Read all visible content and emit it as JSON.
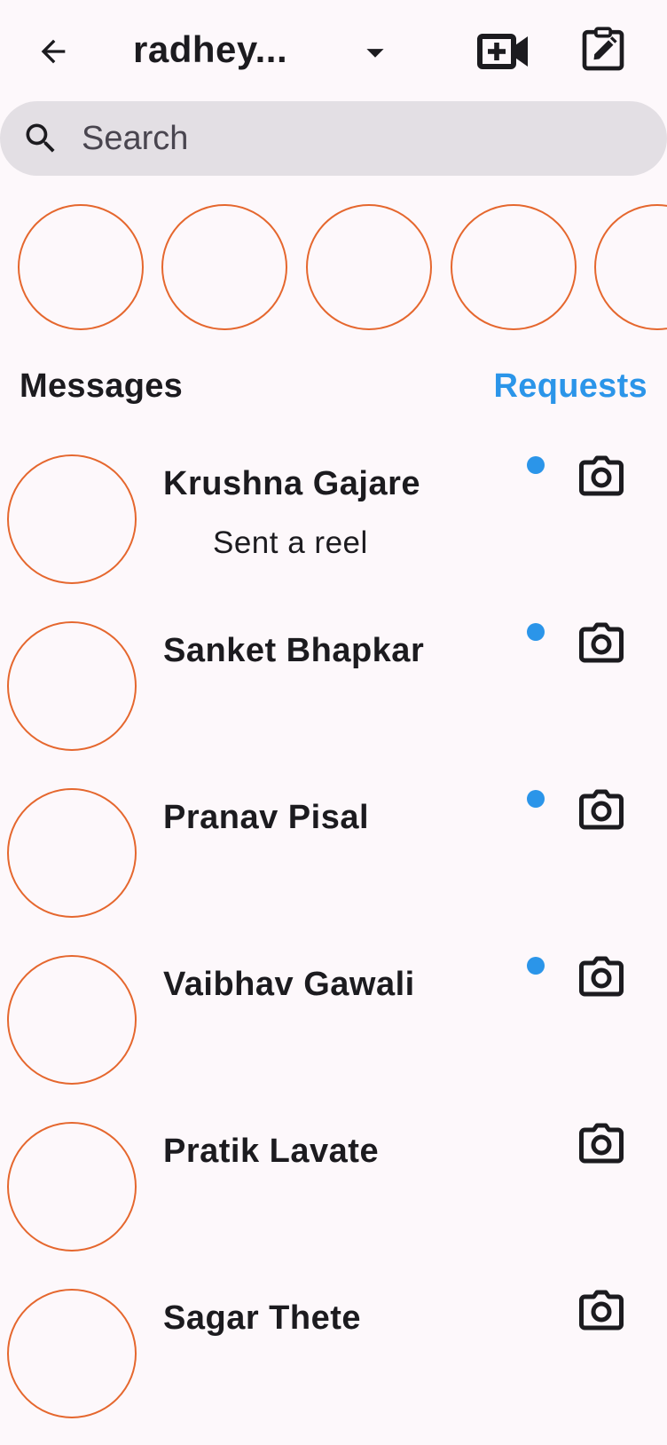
{
  "header": {
    "title": "radhey...",
    "back_icon": "arrow-left-icon",
    "dropdown_icon": "caret-down-icon",
    "video_icon": "video-call-add-icon",
    "compose_icon": "compose-edit-icon"
  },
  "search": {
    "placeholder": "Search",
    "value": ""
  },
  "stories": {
    "visible_count": 5,
    "ring_color": "#e5672e"
  },
  "section": {
    "messages_label": "Messages",
    "requests_label": "Requests",
    "accent_color": "#2b95e9"
  },
  "chats": [
    {
      "name": "Krushna Gajare",
      "subtitle": "Sent a reel",
      "unread": true
    },
    {
      "name": "Sanket Bhapkar",
      "subtitle": "",
      "unread": true
    },
    {
      "name": "Pranav Pisal",
      "subtitle": "",
      "unread": true
    },
    {
      "name": "Vaibhav Gawali",
      "subtitle": "",
      "unread": true
    },
    {
      "name": "Pratik Lavate",
      "subtitle": "",
      "unread": false
    },
    {
      "name": "Sagar Thete",
      "subtitle": "",
      "unread": false
    }
  ]
}
